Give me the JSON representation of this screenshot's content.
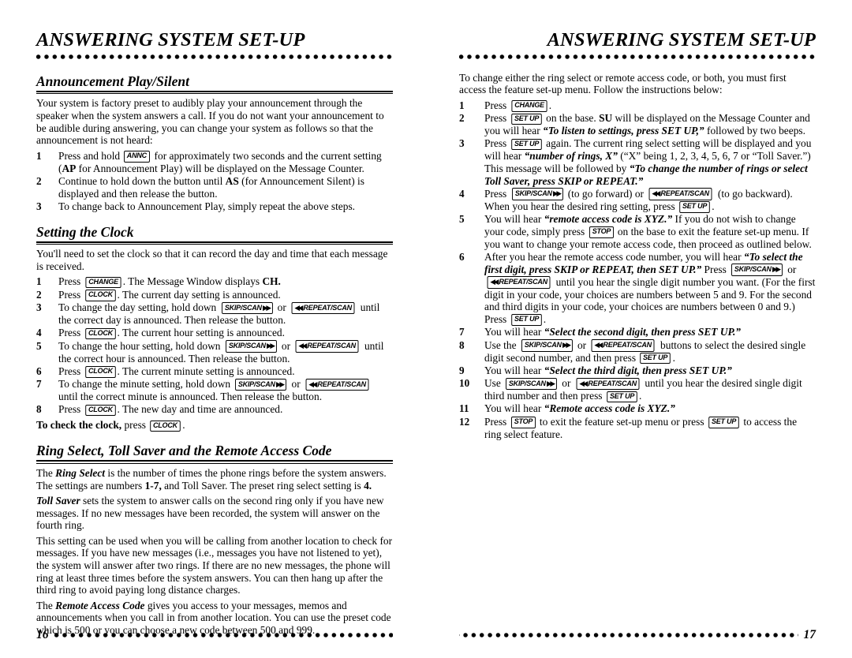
{
  "document": {
    "title": "ANSWERING SYSTEM SET-UP"
  },
  "left_page": {
    "running_head": "ANSWERING SYSTEM SET-UP",
    "folio": "16",
    "sections": [
      {
        "heading": "Announcement Play/Silent",
        "intro": "Your system is factory preset to audibly play your announcement through the speaker when the system answers a call. If you do not want your announcement to be audible during answering, you can change your system as follows so that the announcement is not heard:",
        "steps": [
          {
            "num": "1",
            "text_parts": [
              "Press and hold ",
              "[ANNC]",
              " for approximately two seconds and the current setting (AP for Announcement Play) will be displayed on the Message Counter."
            ]
          },
          {
            "num": "2",
            "text": "Continue to hold down the button until AS (for Announcement Silent) is displayed and then release the button."
          },
          {
            "num": "3",
            "text": "To change back to Announcement Play, simply repeat the above steps."
          }
        ]
      },
      {
        "heading": "Setting the Clock",
        "intro": "You'll need to set the clock so that it can record the day and time that each message is received.",
        "steps": [
          {
            "num": "1",
            "text": "Press [CHANGE]. The Message Window displays CH."
          },
          {
            "num": "2",
            "text": "Press [CLOCK]. The current day setting is announced."
          },
          {
            "num": "3",
            "text": "To change the day setting, hold down [SKIP/SCAN] or [REPEAT/SCAN] until the correct day is announced. Then release the button."
          },
          {
            "num": "4",
            "text": "Press [CLOCK]. The current hour setting is announced."
          },
          {
            "num": "5",
            "text": "To change the hour setting, hold down [SKIP/SCAN] or [REPEAT/SCAN] until the correct hour is announced. Then release the button."
          },
          {
            "num": "6",
            "text": "Press [CLOCK]. The current minute setting is announced."
          },
          {
            "num": "7",
            "text": "To change the minute setting, hold down [SKIP/SCAN] or [REPEAT/SCAN] until the correct minute is announced. Then release the button."
          },
          {
            "num": "8",
            "text": "Press [CLOCK]. The new day and time are announced."
          }
        ],
        "note": "To check the clock, press [CLOCK]."
      },
      {
        "heading": "Ring Select, Toll Saver and the Remote Access Code",
        "paragraphs": [
          "The Ring Select is the number of times the phone rings before the system answers. The settings are numbers 1-7, and Toll Saver. The preset ring select setting is 4.",
          "Toll Saver sets the system to answer calls on the second ring only if you have new messages. If no new messages have been recorded, the system will answer on the fourth ring.",
          "This setting can be used when you will be calling from another location to check for messages. If you have new messages (i.e., messages you have not listened to yet), the system will answer after two rings. If there are no new messages, the phone will ring at least three times before the system answers. You can then hang up after the third ring to avoid paying long distance charges.",
          "The Remote Access Code gives you access to your messages, memos and announcements when you call in from another location. You can use the preset code which is 500 or you can choose a new code between 500 and 999."
        ]
      }
    ]
  },
  "right_page": {
    "running_head": "ANSWERING SYSTEM SET-UP",
    "folio": "17",
    "intro": "To change either the ring select or remote access code, or both, you must first access the feature set-up menu. Follow the instructions below:",
    "steps": [
      {
        "num": "1",
        "text": "Press [CHANGE]."
      },
      {
        "num": "2",
        "text": "Press [SET UP] on the base. SU will be displayed on the Message Counter and you will hear “To listen to settings, press SET UP,” followed by two beeps."
      },
      {
        "num": "3",
        "text": "Press [SET UP] again. The current ring select setting will be displayed and you will hear “number of rings, X” (“X” being 1, 2, 3, 4, 5, 6, 7 or “Toll Saver.”) This message will be followed by “To change the number of rings or select Toll Saver, press SKIP or REPEAT.”"
      },
      {
        "num": "4",
        "text": "Press [SKIP/SCAN] (to go forward) or [REPEAT/SCAN] (to go backward). When you hear the desired ring setting, press [SET UP]."
      },
      {
        "num": "5",
        "text": "You will hear “remote access code is XYZ.” If you do not wish to change your code, simply press [STOP] on the base to exit the feature set-up menu. If you want to change your remote access code, then proceed as outlined below."
      },
      {
        "num": "6",
        "text": "After you hear the remote access code number, you will hear “To select the first digit, press SKIP or REPEAT, then SET UP.” Press [SKIP/SCAN] or [REPEAT/SCAN] until you hear the single digit number you want. (For the first digit in your code, your choices are numbers between 5 and 9. For the second and third digits in your code, your choices are numbers between 0 and 9.) Press [SET UP]."
      },
      {
        "num": "7",
        "text": "You will hear “Select the second digit, then press SET UP.”"
      },
      {
        "num": "8",
        "text": "Use the [SKIP/SCAN] or [REPEAT/SCAN] buttons to select the desired single digit second number, and then press [SET UP]."
      },
      {
        "num": "9",
        "text": "You will hear “Select the third digit, then press SET UP.”"
      },
      {
        "num": "10",
        "text": "Use [SKIP/SCAN] or [REPEAT/SCAN] until you hear the desired single digit third number and then press [SET UP]."
      },
      {
        "num": "11",
        "text": "You will hear “Remote access code is XYZ.”"
      },
      {
        "num": "12",
        "text": "Press [STOP] to exit the feature set-up menu or press [SET UP] to access the ring select feature."
      }
    ]
  },
  "keys": {
    "annc": "ANNC",
    "change": "CHANGE",
    "clock": "CLOCK",
    "setup": "SET UP",
    "stop": "STOP",
    "skip_scan": "SKIP/SCAN",
    "repeat_scan": "REPEAT/SCAN",
    "forward_arrows": "▶▶",
    "back_arrows": "◀◀"
  }
}
